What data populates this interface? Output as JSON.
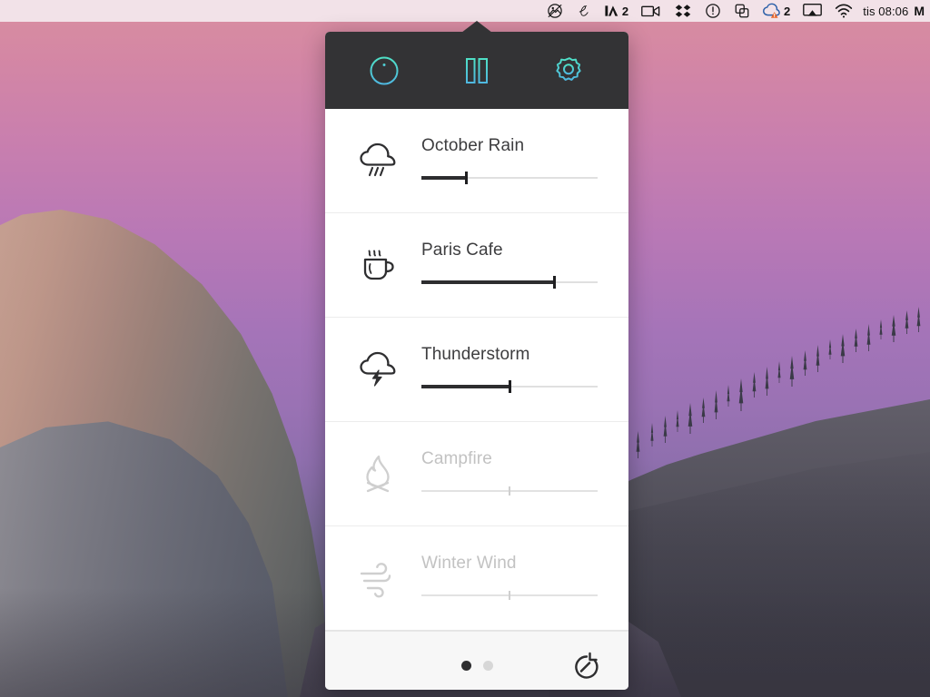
{
  "menubar": {
    "items": [
      {
        "name": "dropbox-screenshot-icon",
        "icon": "camera-circle-icon",
        "badge": ""
      },
      {
        "name": "script-l-icon",
        "icon": "cursive-l-icon",
        "badge": ""
      },
      {
        "name": "adobe-icon",
        "icon": "adobe-a-icon",
        "badge": "2"
      },
      {
        "name": "screen-recorder-icon",
        "icon": "video-camera-icon",
        "badge": ""
      },
      {
        "name": "dropbox-icon",
        "icon": "dropbox-box-icon",
        "badge": ""
      },
      {
        "name": "info-circle-icon",
        "icon": "circle-exclamation-icon",
        "badge": ""
      },
      {
        "name": "window-switcher-icon",
        "icon": "overlapping-squares-icon",
        "badge": ""
      },
      {
        "name": "cloud-sync-warning-icon",
        "icon": "cloud-warning-icon",
        "badge": "2"
      },
      {
        "name": "airplay-icon",
        "icon": "airplay-screen-icon",
        "badge": ""
      },
      {
        "name": "wifi-icon",
        "icon": "wifi-waves-icon",
        "badge": ""
      }
    ],
    "clock": "tis 08:06",
    "user_initial": "M"
  },
  "panel": {
    "header": {
      "info_label": "info",
      "pause_label": "pause",
      "settings_label": "settings",
      "accent_color": "#45d6c8",
      "background_color": "#333335"
    },
    "sounds": [
      {
        "name": "October Rain",
        "icon": "rain-cloud-icon",
        "volume": 25,
        "active": true
      },
      {
        "name": "Paris Cafe",
        "icon": "coffee-cup-icon",
        "volume": 75,
        "active": true
      },
      {
        "name": "Thunderstorm",
        "icon": "thunder-cloud-icon",
        "volume": 50,
        "active": true
      },
      {
        "name": "Campfire",
        "icon": "campfire-icon",
        "volume": 50,
        "active": false
      },
      {
        "name": "Winter Wind",
        "icon": "wind-icon",
        "volume": 50,
        "active": false
      }
    ],
    "footer": {
      "pages": [
        {
          "label": "1",
          "active": true
        },
        {
          "label": "2",
          "active": false
        }
      ],
      "timer_label": "timer"
    }
  }
}
